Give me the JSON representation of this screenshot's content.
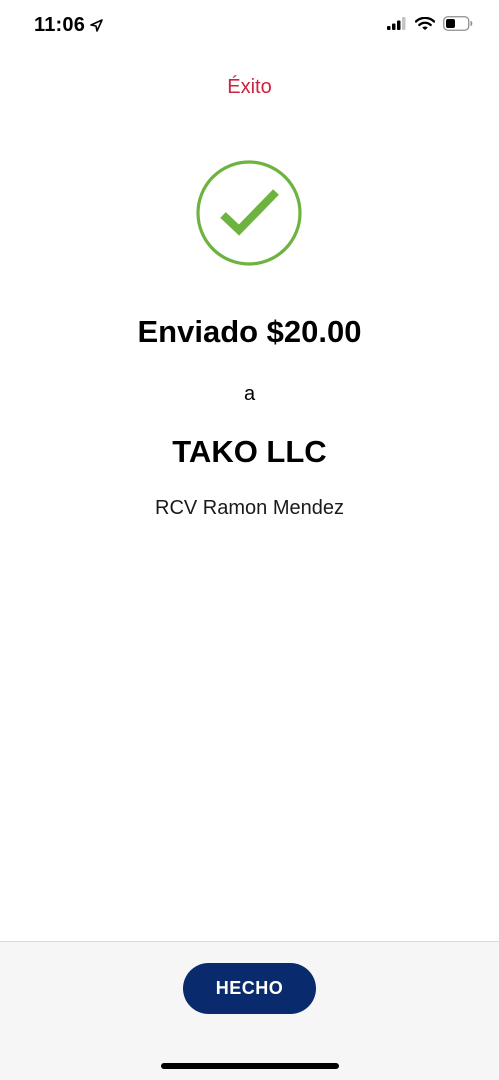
{
  "status_bar": {
    "time": "11:06",
    "icons": [
      "location-arrow-icon",
      "cellular-signal-icon",
      "wifi-icon",
      "battery-icon"
    ]
  },
  "header": {
    "title": "Éxito"
  },
  "result": {
    "icon": "check-circle-icon",
    "sent_amount": "Enviado $20.00",
    "to_label": "a",
    "recipient_name": "TAKO LLC",
    "recipient_detail": "RCV Ramon Mendez"
  },
  "footer": {
    "done_label": "HECHO"
  },
  "colors": {
    "accent_red": "#d0213d",
    "success_green": "#6db33f",
    "button_navy": "#0a2a6e",
    "footer_bg": "#f6f6f6"
  }
}
